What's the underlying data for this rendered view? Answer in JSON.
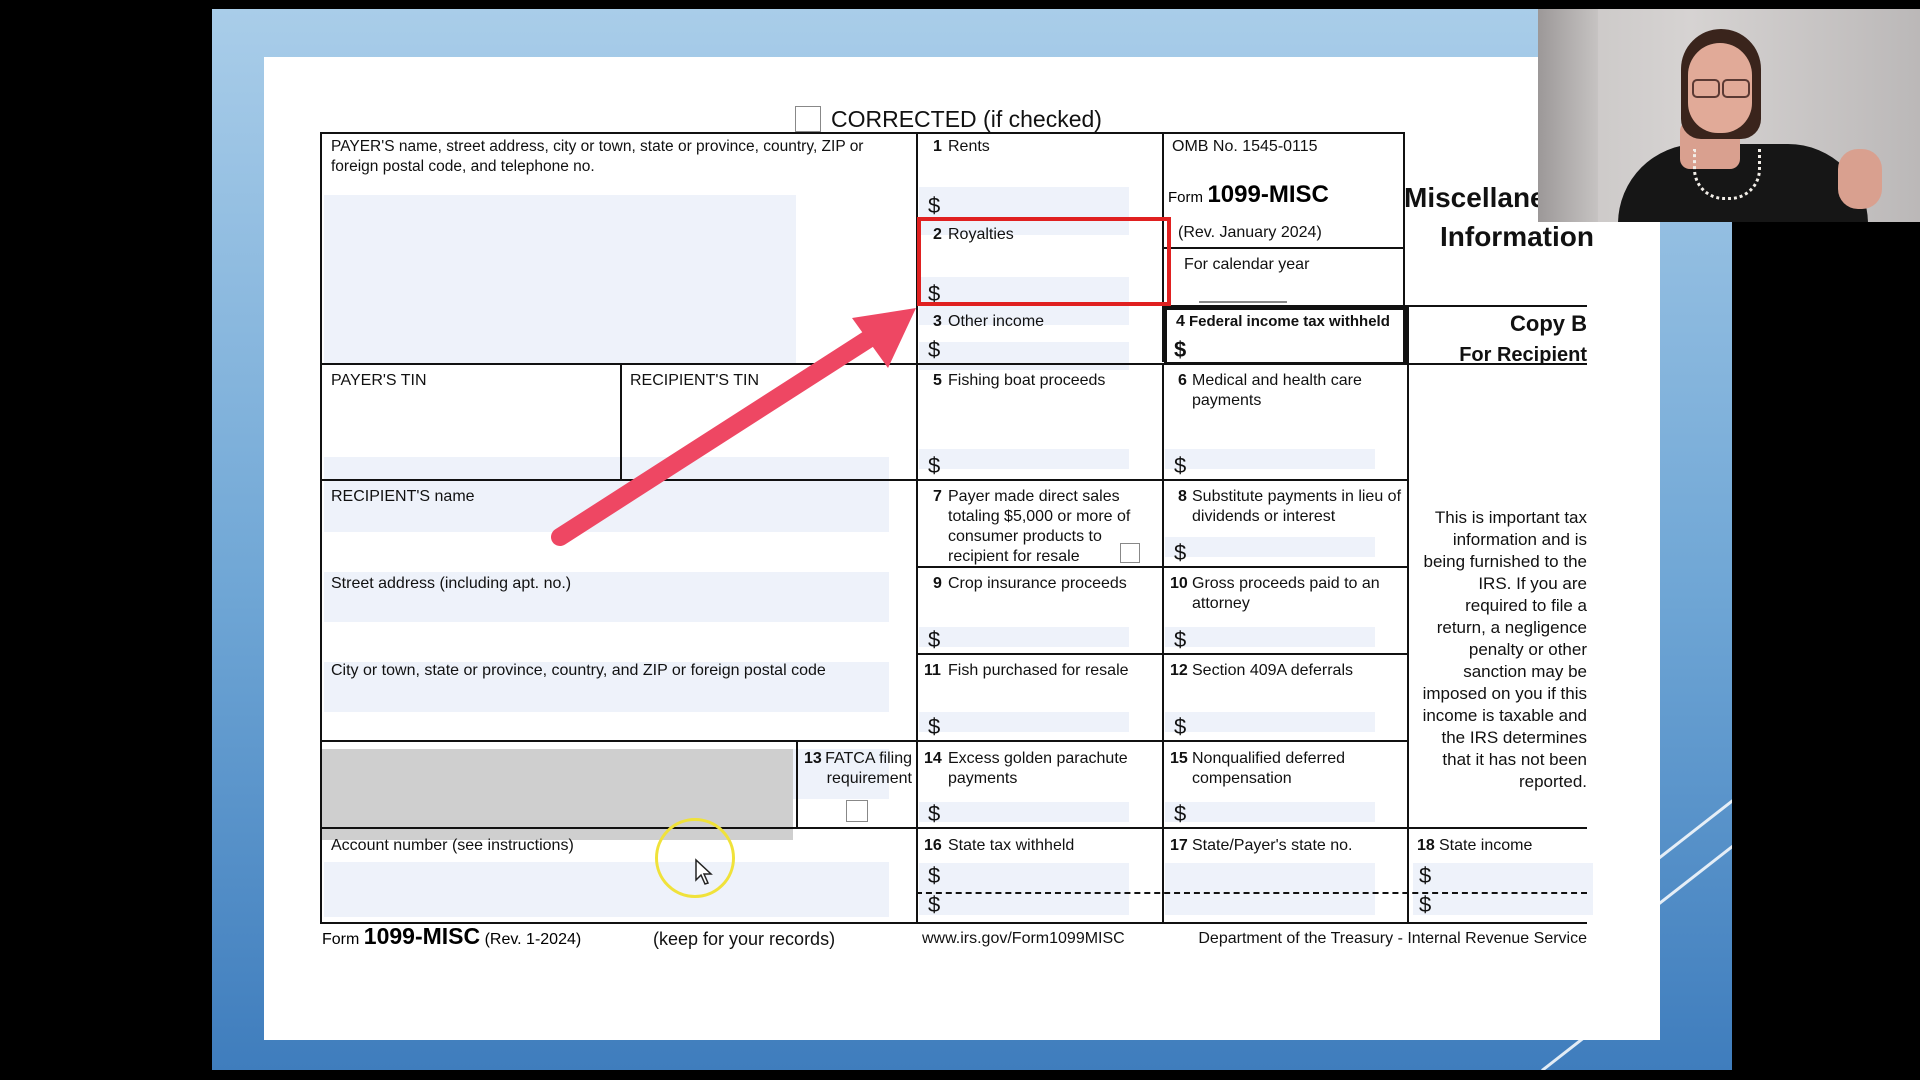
{
  "form": {
    "corrected": "CORRECTED (if checked)",
    "payer_block": "PAYER'S name, street address, city or town, state or province, country, ZIP or foreign postal code, and telephone no.",
    "payer_tin": "PAYER'S TIN",
    "recipient_tin": "RECIPIENT'S TIN",
    "recipient_name": "RECIPIENT'S name",
    "street_address": "Street address (including apt. no.)",
    "city": "City or town, state or province, country, and ZIP or foreign postal code",
    "fatca_num": "13",
    "fatca": "FATCA filing requirement",
    "account_number": "Account number (see instructions)",
    "omb": "OMB No. 1545-0115",
    "form_word": "Form",
    "form_name": "1099-MISC",
    "rev": "(Rev. January 2024)",
    "calendar_year": "For calendar year",
    "title_line1": "Miscellaneous",
    "title_line2": "Information",
    "copy": "Copy B",
    "for_recipient": "For Recipient",
    "notice": "This is important tax information and is being furnished to the IRS. If you are required to file a return, a negligence penalty or other sanction may be imposed on you if this income is taxable and the IRS determines that it has not been reported.",
    "dollar": "$",
    "boxes": {
      "b1": {
        "n": "1",
        "label": "Rents"
      },
      "b2": {
        "n": "2",
        "label": "Royalties"
      },
      "b3": {
        "n": "3",
        "label": "Other income"
      },
      "b4": {
        "n": "4",
        "label": "Federal income tax withheld"
      },
      "b5": {
        "n": "5",
        "label": "Fishing boat proceeds"
      },
      "b6": {
        "n": "6",
        "label": "Medical and health care payments"
      },
      "b7": {
        "n": "7",
        "label": "Payer made direct sales totaling $5,000 or more of consumer products to recipient for resale"
      },
      "b8": {
        "n": "8",
        "label": "Substitute payments in lieu of dividends or interest"
      },
      "b9": {
        "n": "9",
        "label": "Crop insurance proceeds"
      },
      "b10": {
        "n": "10",
        "label": "Gross proceeds paid to an attorney"
      },
      "b11": {
        "n": "11",
        "label": "Fish purchased for resale"
      },
      "b12": {
        "n": "12",
        "label": "Section 409A deferrals"
      },
      "b14": {
        "n": "14",
        "label": "Excess golden parachute payments"
      },
      "b15": {
        "n": "15",
        "label": "Nonqualified deferred compensation"
      },
      "b16": {
        "n": "16",
        "label": "State tax withheld"
      },
      "b17": {
        "n": "17",
        "label": "State/Payer's state no."
      },
      "b18": {
        "n": "18",
        "label": "State income"
      }
    },
    "footer": {
      "form_word": "Form",
      "form_name": "1099-MISC",
      "rev": "(Rev. 1-2024)",
      "keep": "(keep for your records)",
      "url": "www.irs.gov/Form1099MISC",
      "dept": "Department of the Treasury - Internal Revenue Service"
    }
  },
  "annotation": {
    "highlight_color": "#e02020",
    "arrow_color": "#ee4763",
    "cursor_ring_color": "#f0e23a"
  }
}
